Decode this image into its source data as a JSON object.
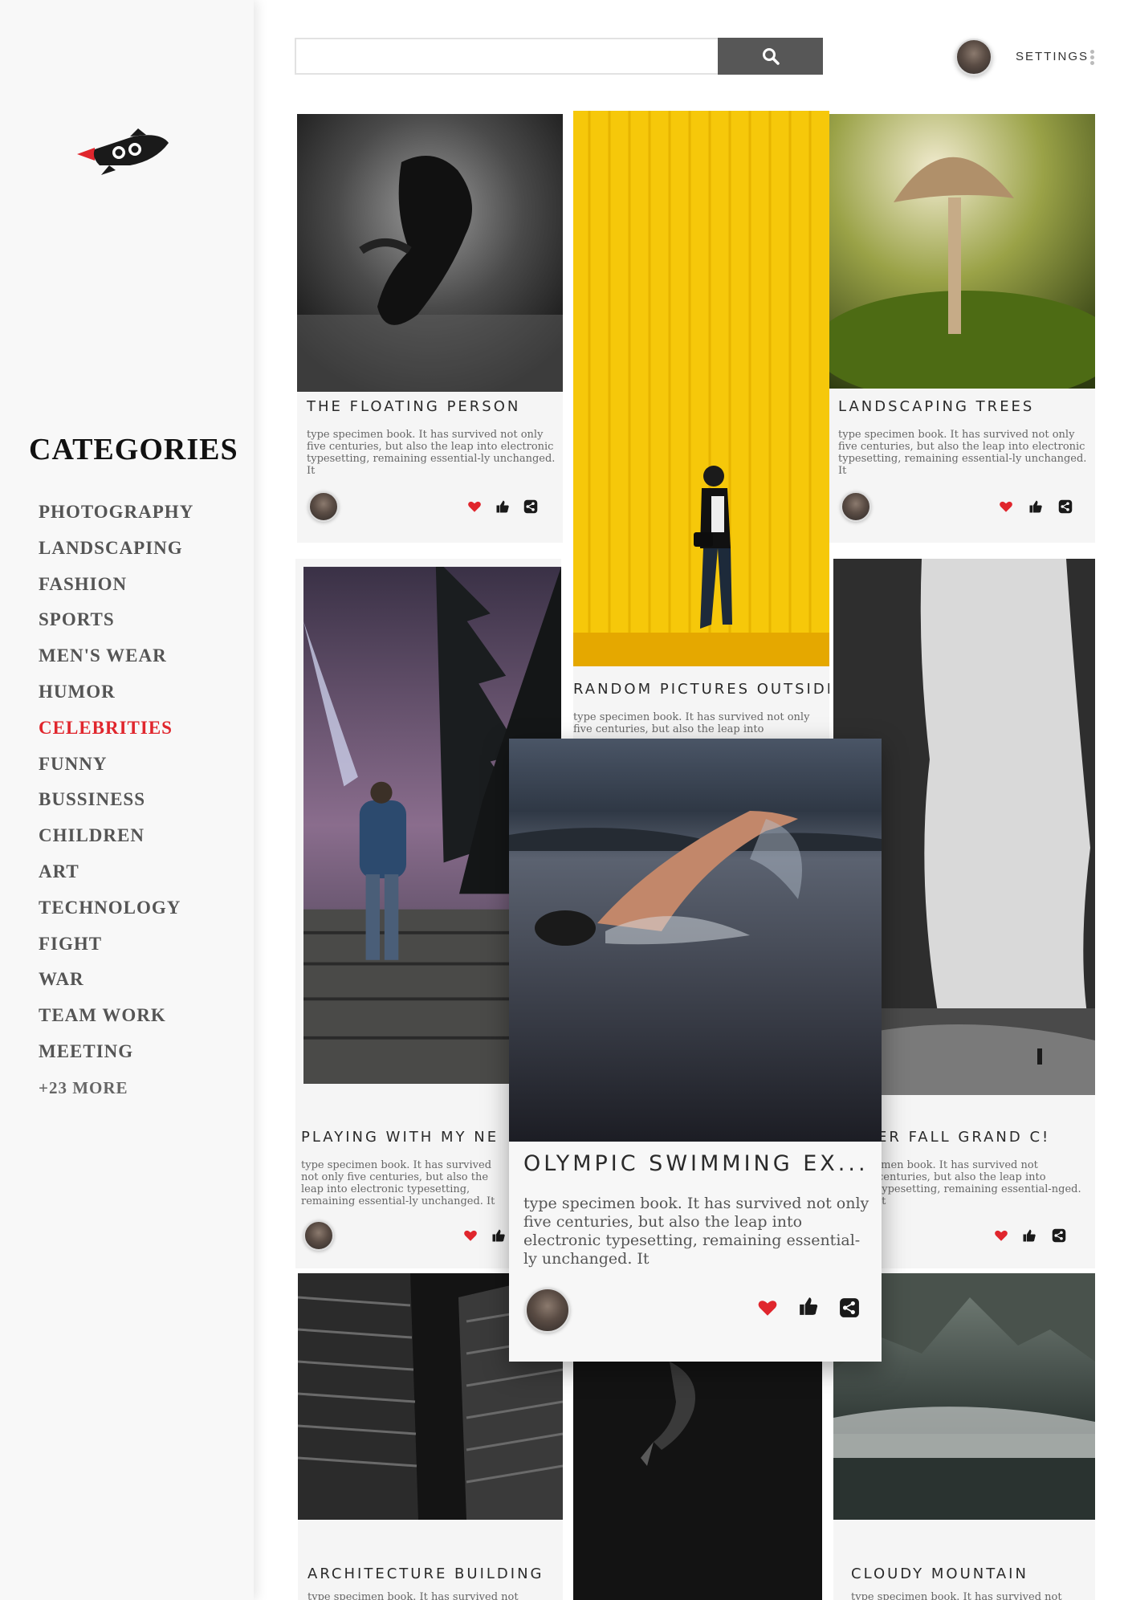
{
  "sidebar": {
    "categories_title": "CATEGORIES",
    "categories": [
      {
        "label": "PHOTOGRAPHY",
        "active": false
      },
      {
        "label": "LANDSCAPING",
        "active": false
      },
      {
        "label": "FASHION",
        "active": false
      },
      {
        "label": "SPORTS",
        "active": false
      },
      {
        "label": "MEN'S WEAR",
        "active": false
      },
      {
        "label": "HUMOR",
        "active": false
      },
      {
        "label": "CELEBRITIES",
        "active": true
      },
      {
        "label": "FUNNY",
        "active": false
      },
      {
        "label": "BUSSINESS",
        "active": false
      },
      {
        "label": "CHILDREN",
        "active": false
      },
      {
        "label": "ART",
        "active": false
      },
      {
        "label": "TECHNOLOGY",
        "active": false
      },
      {
        "label": "FIGHT",
        "active": false
      },
      {
        "label": "WAR",
        "active": false
      },
      {
        "label": "TEAM WORK",
        "active": false
      },
      {
        "label": "MEETING",
        "active": false
      }
    ],
    "more_label": "+23 MORE"
  },
  "header": {
    "search_placeholder": "",
    "settings_label": "SETTINGS"
  },
  "colors": {
    "accent": "#e0262d",
    "search_button": "#575757",
    "sidebar_bg": "#f8f8f8",
    "card_bg": "#f5f5f5"
  },
  "cards": {
    "floating": {
      "title": "THE FLOATING PERSON",
      "body": "type specimen book. It has survived not only five centuries, but also the leap into electronic typesetting, remaining essential-ly unchanged. It"
    },
    "random": {
      "title": "RANDOM PICTURES OUTSIDE",
      "body": "type specimen book. It has survived not only five centuries, but also the leap into"
    },
    "trees": {
      "title": "LANDSCAPING TREES",
      "body": "type specimen book. It has survived not only five centuries, but also the leap into electronic typesetting, remaining essential-ly unchanged. It"
    },
    "playing": {
      "title": "PLAYING WITH MY NE",
      "body": "type specimen book. It has survived not only five centuries, but also the leap into electronic typesetting, remaining essential-ly unchanged. It"
    },
    "waterfall": {
      "title": "ER FALL GRAND C!",
      "body": "imen book. It has survived not centuries, but also the leap into typesetting, remaining essential-nged. It"
    },
    "olympic": {
      "title": "OLYMPIC SWIMMING EX...",
      "body": "type specimen book. It has survived not only five centuries, but also the leap into electronic typesetting, remaining essential-ly unchanged. It"
    },
    "architecture": {
      "title": "ARCHITECTURE BUILDING",
      "body": "type specimen book. It has survived not"
    },
    "mountain": {
      "title": "CLOUDY MOUNTAIN",
      "body": "type specimen book. It has survived not"
    }
  }
}
